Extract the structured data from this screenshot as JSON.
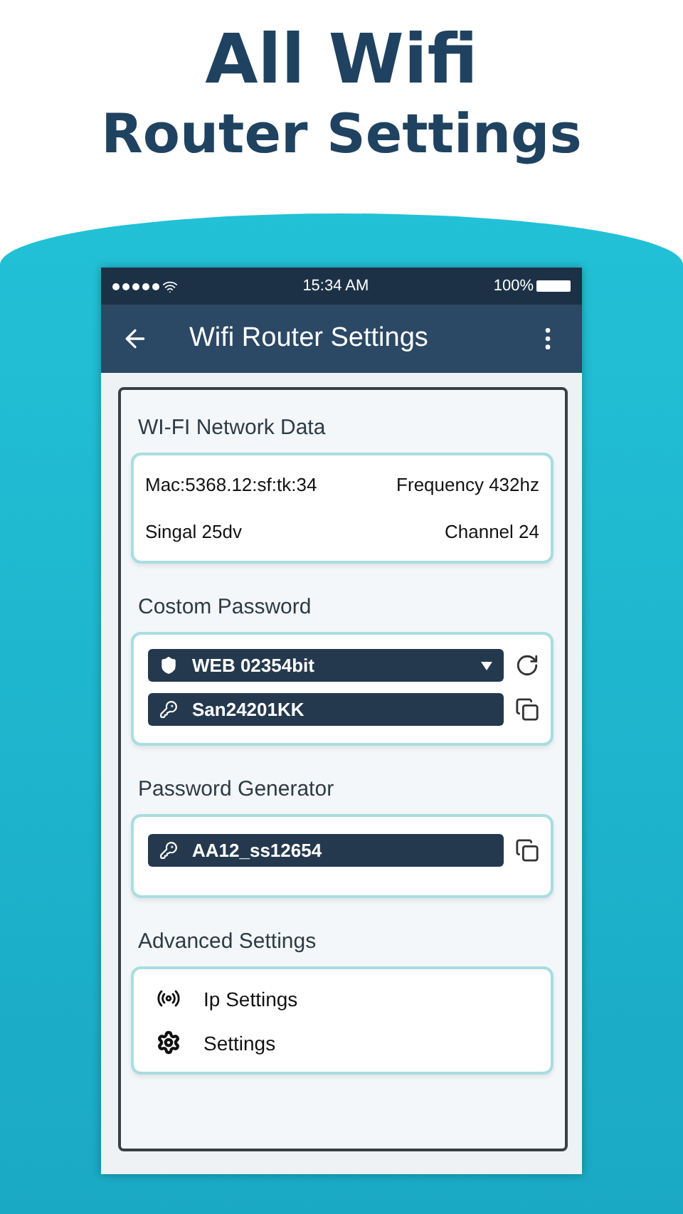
{
  "headline": [
    "All Wifi",
    "Router Settings"
  ],
  "status_bar": {
    "time": "15:34 AM",
    "battery": "100%"
  },
  "app_bar": {
    "title": "Wifi Router Settings"
  },
  "network": {
    "heading": "WI-FI Network Data",
    "rows": [
      [
        "Mac:5368.12:sf:tk:34",
        "Frequency 432hz"
      ],
      [
        "Singal 25dv",
        "Channel 24"
      ]
    ]
  },
  "custom_password": {
    "heading": "Costom Password",
    "fields": [
      {
        "kind": "dropdown",
        "value": "WEB 02354bit"
      },
      {
        "kind": "key",
        "value": "San24201KK"
      }
    ]
  },
  "generator": {
    "heading": "Password Generator",
    "value": "AA12_ss12654"
  },
  "advanced": {
    "heading": "Advanced Settings",
    "items": [
      {
        "kind": "hotspot",
        "label": "Ip Settings"
      },
      {
        "kind": "gear",
        "label": "Settings"
      }
    ]
  }
}
